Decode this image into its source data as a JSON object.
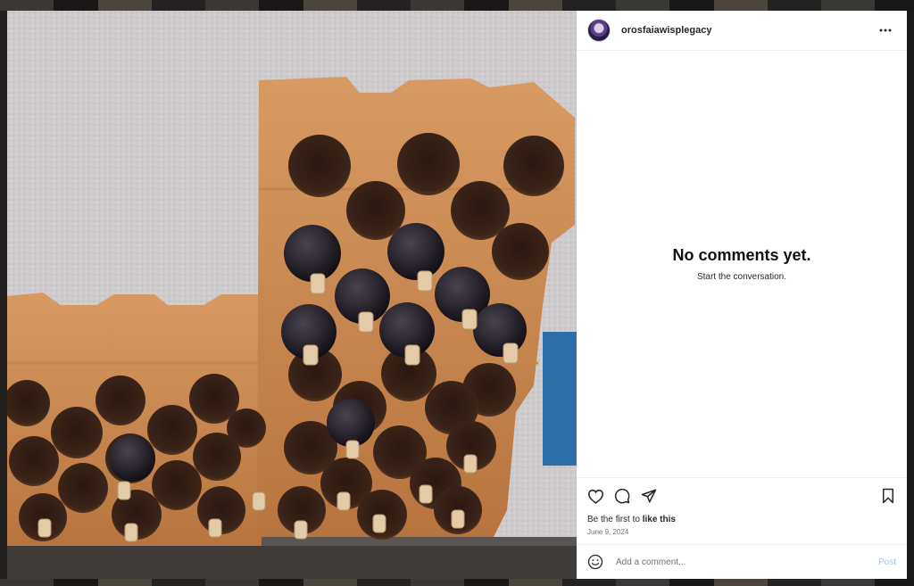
{
  "post": {
    "username": "orosfaiawisplegacy",
    "image_description_icon": "wine-rack-photo",
    "empty_title": "No comments yet.",
    "empty_subtitle": "Start the conversation.",
    "likes_prefix": "Be the first to ",
    "likes_link": "like this",
    "date": "June 9, 2024"
  },
  "composer": {
    "placeholder": "Add a comment...",
    "post_label": "Post"
  },
  "icons": {
    "like": "heart-icon",
    "comment": "comment-icon",
    "share": "share-icon",
    "save": "bookmark-icon",
    "emoji": "emoji-icon",
    "more": "more-icon"
  },
  "colors": {
    "post_button": "#9fc9f6",
    "text": "#262626",
    "muted": "#737373"
  }
}
